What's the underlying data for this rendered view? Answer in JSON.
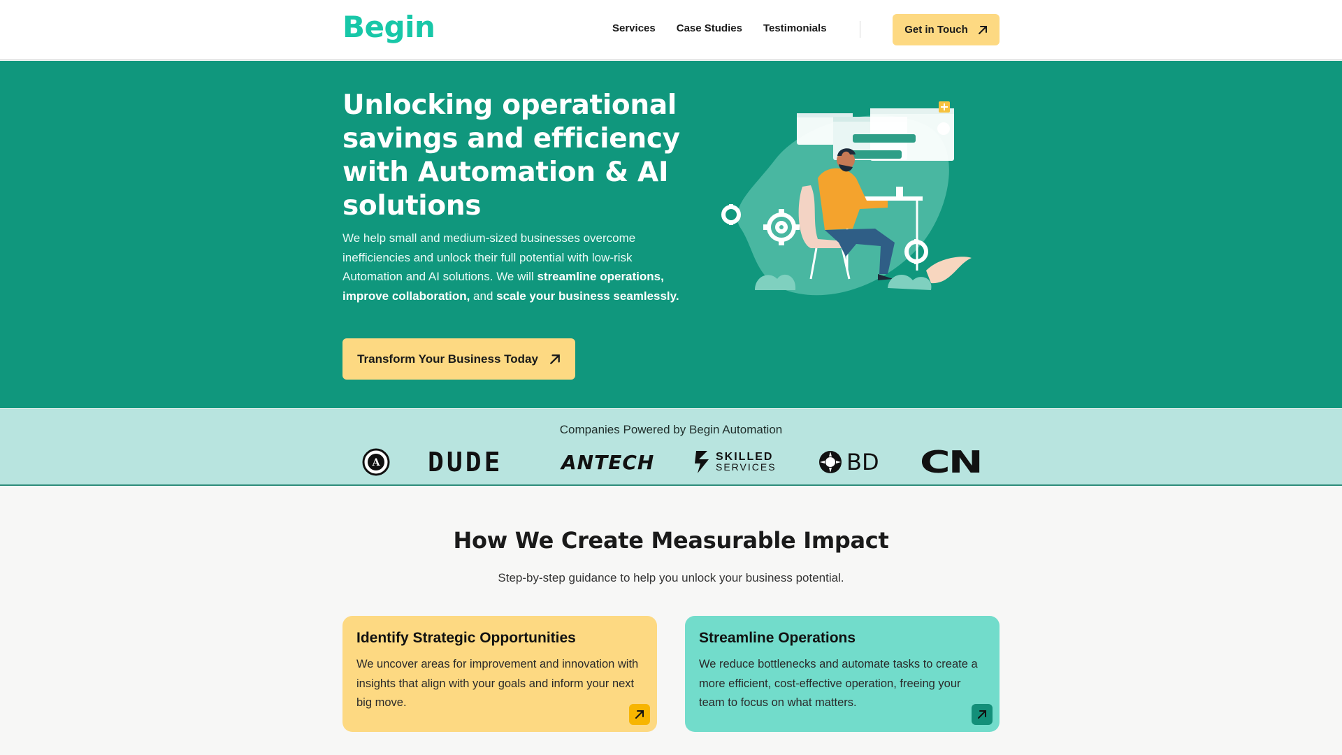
{
  "header": {
    "logo": "Begin",
    "nav": [
      "Services",
      "Case Studies",
      "Testimonials"
    ],
    "cta_label": "Get in Touch"
  },
  "hero": {
    "title": "Unlocking operational savings and efficiency with Automation & AI solutions",
    "desc_plain_1": "We help small and medium-sized businesses overcome inefficiencies and unlock their full potential with low-risk Automation and AI solutions. We will ",
    "desc_bold_1": "streamline operations, improve collaboration,",
    "desc_plain_2": " and ",
    "desc_bold_2": "scale your business seamlessly.",
    "button_label": "Transform Your Business Today",
    "illustration_icon": "person-at-computer-illustration"
  },
  "logos": {
    "caption": "Companies Powered by Begin Automation",
    "items": [
      {
        "name": "circle-badge-logo",
        "text": "A"
      },
      {
        "name": "dude-logo",
        "text": "DUDE"
      },
      {
        "name": "antech-logo",
        "text": "ANTECH"
      },
      {
        "name": "skilled-services-logo",
        "text_1": "SKILLED",
        "text_2": "SERVICES"
      },
      {
        "name": "bd-logo",
        "text": "BD"
      },
      {
        "name": "cn-logo",
        "text": "CN"
      }
    ]
  },
  "impact": {
    "title": "How We Create Measurable Impact",
    "subtitle": "Step-by-step guidance to help you unlock your business potential.",
    "cards": [
      {
        "title": "Identify Strategic Opportunities",
        "text": "We uncover areas for improvement and innovation with insights that align with your goals and inform your next big move.",
        "color": "#fdd982",
        "arrow_color": "#f7b500"
      },
      {
        "title": "Streamline Operations",
        "text": "We reduce bottlenecks and automate tasks to create a more efficient, cost-effective operation, freeing your team to focus on what matters.",
        "color": "#72dccb",
        "arrow_color": "#138f79"
      }
    ]
  },
  "colors": {
    "brand_teal": "#10977d",
    "logo_teal": "#18c7a8",
    "accent_yellow": "#fdd982",
    "strip_bg": "#b8e4df"
  }
}
